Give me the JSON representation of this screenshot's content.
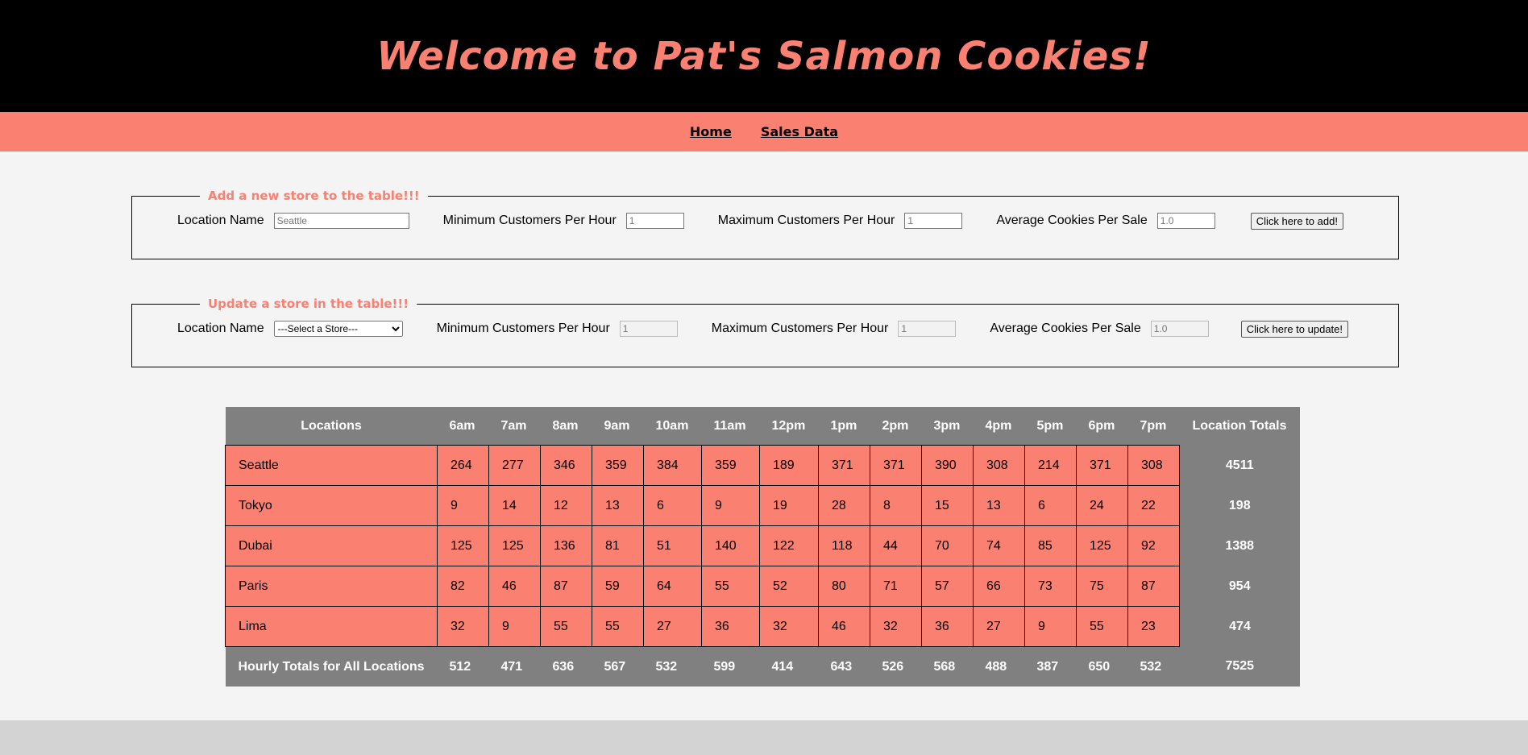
{
  "header": {
    "title": "Welcome to Pat's Salmon Cookies!"
  },
  "nav": {
    "items": [
      "Home",
      "Sales Data"
    ]
  },
  "add_form": {
    "legend": "Add a new store to the table!!!",
    "location_label": "Location Name",
    "location_placeholder": "Seattle",
    "min_label": "Minimum Customers Per Hour",
    "min_placeholder": "1",
    "max_label": "Maximum Customers Per Hour",
    "max_placeholder": "1",
    "avg_label": "Average Cookies Per Sale",
    "avg_placeholder": "1.0",
    "button": "Click here to add!"
  },
  "update_form": {
    "legend": "Update a store in the table!!!",
    "location_label": "Location Name",
    "select_value": "---Select a Store---",
    "min_label": "Minimum Customers Per Hour",
    "min_placeholder": "1",
    "max_label": "Maximum Customers Per Hour",
    "max_placeholder": "1",
    "avg_label": "Average Cookies Per Sale",
    "avg_placeholder": "1.0",
    "button": "Click here to update!"
  },
  "table": {
    "headers": [
      "Locations",
      "6am",
      "7am",
      "8am",
      "9am",
      "10am",
      "11am",
      "12pm",
      "1pm",
      "2pm",
      "3pm",
      "4pm",
      "5pm",
      "6pm",
      "7pm",
      "Location Totals"
    ],
    "rows": [
      {
        "name": "Seattle",
        "hours": [
          264,
          277,
          346,
          359,
          384,
          359,
          189,
          371,
          371,
          390,
          308,
          214,
          371,
          308
        ],
        "total": 4511
      },
      {
        "name": "Tokyo",
        "hours": [
          9,
          14,
          12,
          13,
          6,
          9,
          19,
          28,
          8,
          15,
          13,
          6,
          24,
          22
        ],
        "total": 198
      },
      {
        "name": "Dubai",
        "hours": [
          125,
          125,
          136,
          81,
          51,
          140,
          122,
          118,
          44,
          70,
          74,
          85,
          125,
          92
        ],
        "total": 1388
      },
      {
        "name": "Paris",
        "hours": [
          82,
          46,
          87,
          59,
          64,
          55,
          52,
          80,
          71,
          57,
          66,
          73,
          75,
          87
        ],
        "total": 954
      },
      {
        "name": "Lima",
        "hours": [
          32,
          9,
          55,
          55,
          27,
          36,
          32,
          46,
          32,
          36,
          27,
          9,
          55,
          23
        ],
        "total": 474
      }
    ],
    "footer": {
      "name": "Hourly Totals for All Locations",
      "hours": [
        512,
        471,
        636,
        567,
        532,
        599,
        414,
        643,
        526,
        568,
        488,
        387,
        650,
        532
      ],
      "total": 7525
    }
  },
  "colors": {
    "accent": "#fa8072",
    "header_bg": "#000000",
    "table_head": "#808080",
    "page_bg": "#f4f4f4",
    "footer_bg": "#d3d3d3"
  }
}
